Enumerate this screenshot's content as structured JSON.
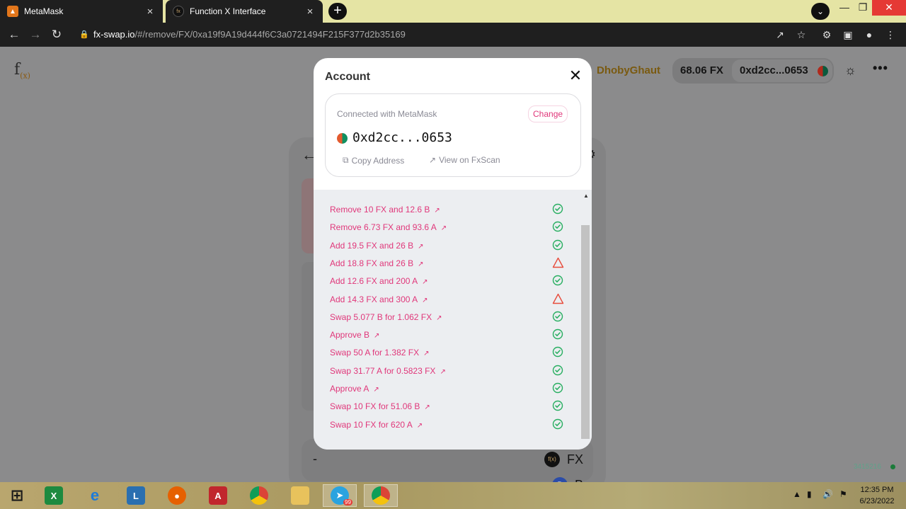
{
  "browser": {
    "tabs": [
      {
        "title": "MetaMask",
        "icon": "metamask-fox-icon"
      },
      {
        "title": "Function X Interface",
        "icon": "function-x-icon"
      }
    ],
    "url_host": "fx-swap.io",
    "url_path": "/#/remove/FX/0xa19f9A19d444f6C3a0721494F215F377d2b35169"
  },
  "header": {
    "logo": "f",
    "logo_sub": "(x)",
    "network": "DhobyGhaut",
    "balance": "68.06 FX",
    "address": "0xd2cc...0653"
  },
  "card": {
    "rows": [
      {
        "value": "-",
        "token": "FX",
        "token_icon": "f(x)"
      },
      {
        "value": "-",
        "token": "B",
        "token_icon": "B"
      }
    ]
  },
  "modal": {
    "title": "Account",
    "connected_text": "Connected with MetaMask",
    "change_label": "Change",
    "address": "0xd2cc...0653",
    "copy_label": "Copy Address",
    "view_label": "View on FxScan",
    "transactions": [
      {
        "text": "Remove 10 FX and 12.6 B",
        "status": "success"
      },
      {
        "text": "Remove 6.73 FX and 93.6 A",
        "status": "success"
      },
      {
        "text": "Add 19.5 FX and 26 B",
        "status": "success"
      },
      {
        "text": "Add 18.8 FX and 26 B",
        "status": "failed"
      },
      {
        "text": "Add 12.6 FX and 200 A",
        "status": "success"
      },
      {
        "text": "Add 14.3 FX and 300 A",
        "status": "failed"
      },
      {
        "text": "Swap 5.077 B for 1.062 FX",
        "status": "success"
      },
      {
        "text": "Approve B",
        "status": "success"
      },
      {
        "text": "Swap 50 A for 1.382 FX",
        "status": "success"
      },
      {
        "text": "Swap 31.77 A for 0.5823 FX",
        "status": "success"
      },
      {
        "text": "Approve A",
        "status": "success"
      },
      {
        "text": "Swap 10 FX for 51.06 B",
        "status": "success"
      },
      {
        "text": "Swap 10 FX for 620 A",
        "status": "success"
      }
    ]
  },
  "footer": {
    "version": "3415216"
  },
  "taskbar": {
    "time": "12:35 PM",
    "date": "6/23/2022",
    "telegram_badge": "99"
  },
  "colors": {
    "accent_pink": "#e0377a",
    "success_green": "#27ae60",
    "failed_red": "#e74c3c"
  }
}
